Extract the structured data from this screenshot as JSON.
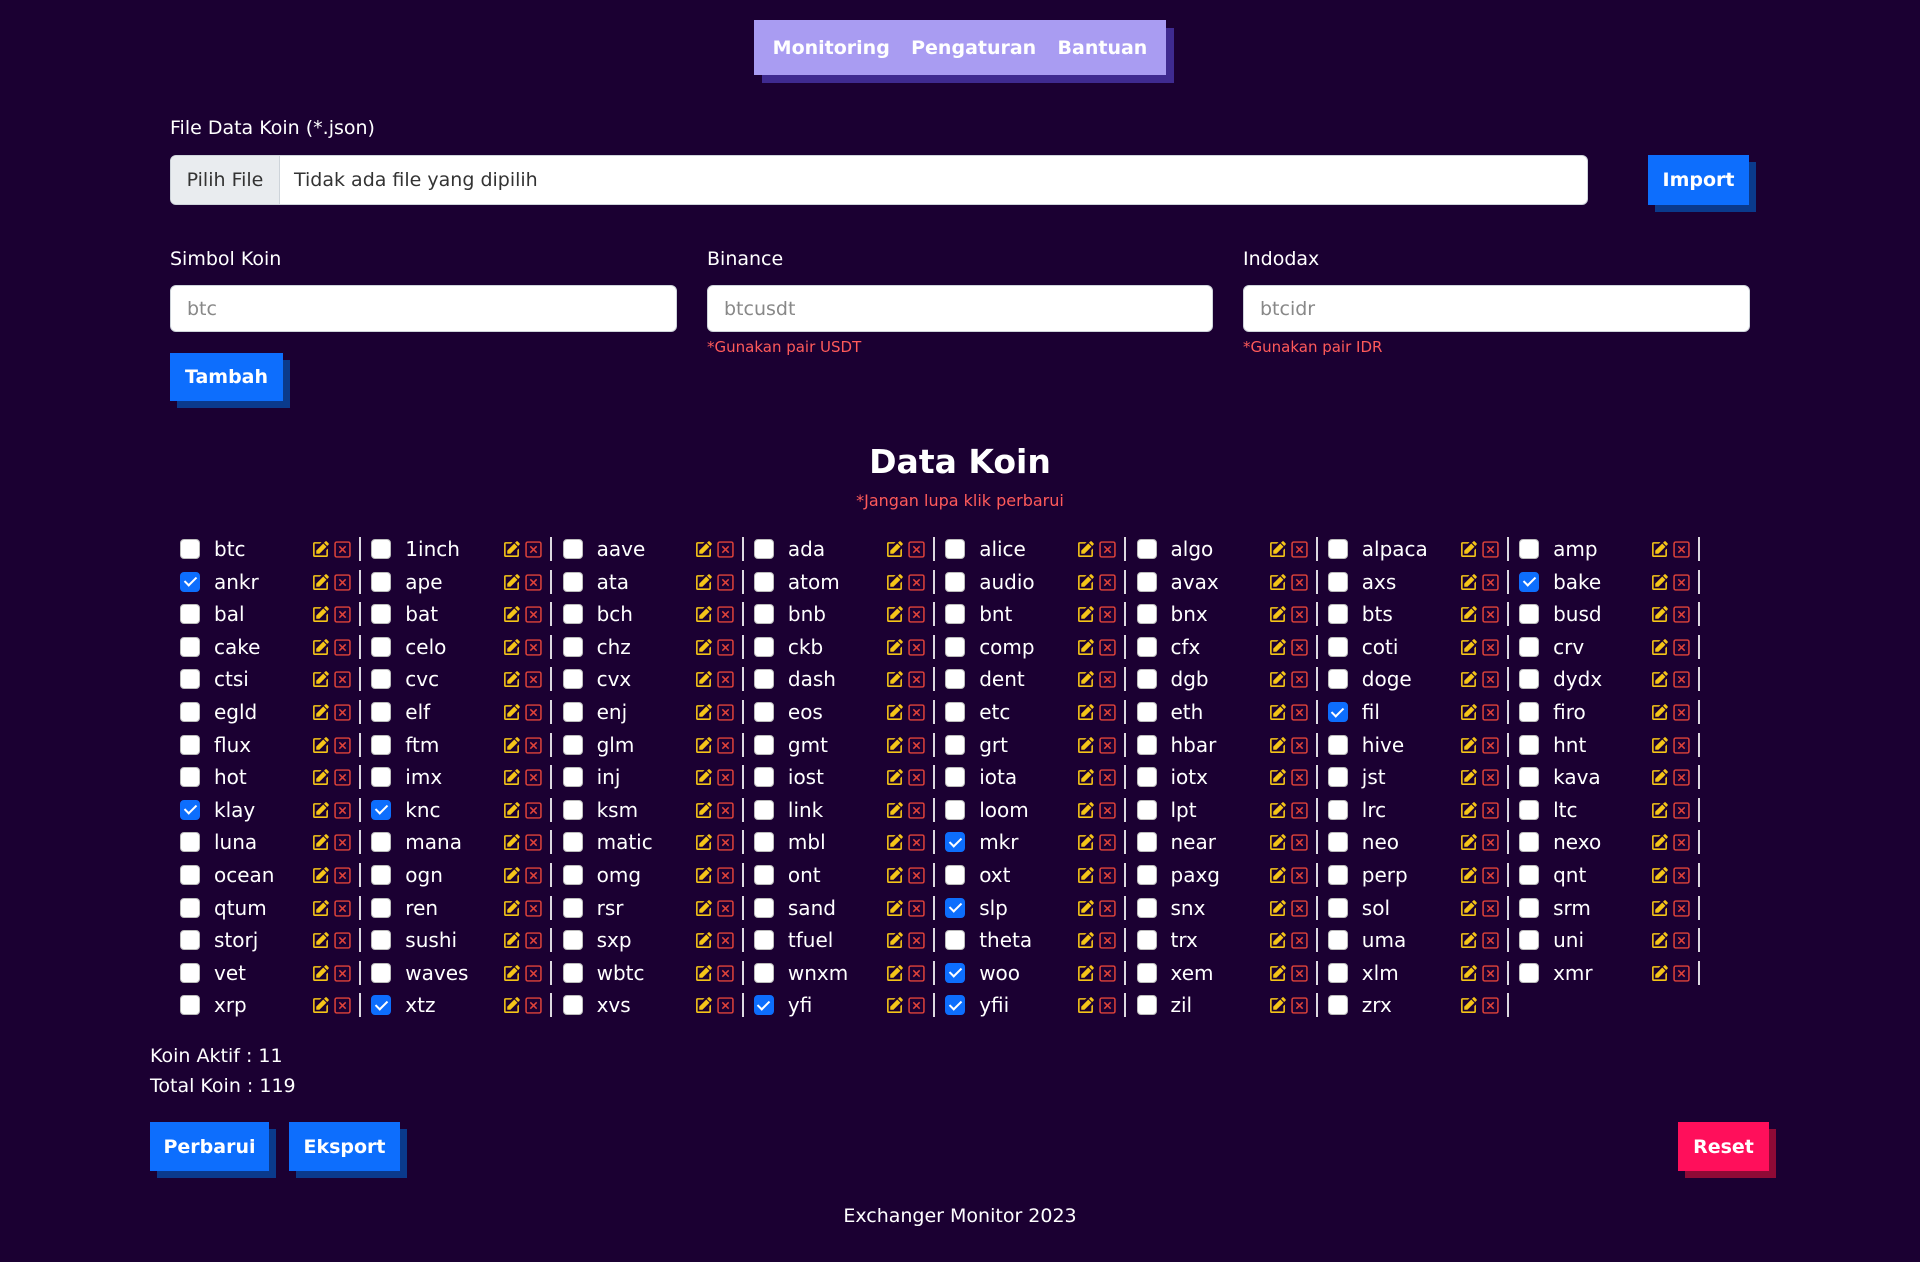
{
  "nav": {
    "items": [
      "Monitoring",
      "Pengaturan",
      "Bantuan"
    ]
  },
  "file_section": {
    "label": "File Data Koin (*.json)",
    "choose_label": "Pilih File",
    "status": "Tidak ada file yang dipilih",
    "import_label": "Import"
  },
  "form": {
    "symbol": {
      "label": "Simbol Koin",
      "placeholder": "btc"
    },
    "binance": {
      "label": "Binance",
      "placeholder": "btcusdt",
      "hint": "*Gunakan pair USDT"
    },
    "indodax": {
      "label": "Indodax",
      "placeholder": "btcidr",
      "hint": "*Gunakan pair IDR"
    },
    "add_label": "Tambah"
  },
  "data_section": {
    "title": "Data Koin",
    "hint": "*Jangan lupa klik perbarui"
  },
  "coins": [
    [
      "btc",
      "1inch",
      "aave",
      "ada",
      "alice",
      "algo",
      "alpaca",
      "amp"
    ],
    [
      "ankr",
      "ape",
      "ata",
      "atom",
      "audio",
      "avax",
      "axs",
      "bake"
    ],
    [
      "bal",
      "bat",
      "bch",
      "bnb",
      "bnt",
      "bnx",
      "bts",
      "busd"
    ],
    [
      "cake",
      "celo",
      "chz",
      "ckb",
      "comp",
      "cfx",
      "coti",
      "crv"
    ],
    [
      "ctsi",
      "cvc",
      "cvx",
      "dash",
      "dent",
      "dgb",
      "doge",
      "dydx"
    ],
    [
      "egld",
      "elf",
      "enj",
      "eos",
      "etc",
      "eth",
      "fil",
      "firo"
    ],
    [
      "flux",
      "ftm",
      "glm",
      "gmt",
      "grt",
      "hbar",
      "hive",
      "hnt"
    ],
    [
      "hot",
      "imx",
      "inj",
      "iost",
      "iota",
      "iotx",
      "jst",
      "kava"
    ],
    [
      "klay",
      "knc",
      "ksm",
      "link",
      "loom",
      "lpt",
      "lrc",
      "ltc"
    ],
    [
      "luna",
      "mana",
      "matic",
      "mbl",
      "mkr",
      "near",
      "neo",
      "nexo"
    ],
    [
      "ocean",
      "ogn",
      "omg",
      "ont",
      "oxt",
      "paxg",
      "perp",
      "qnt"
    ],
    [
      "qtum",
      "ren",
      "rsr",
      "sand",
      "slp",
      "snx",
      "sol",
      "srm"
    ],
    [
      "storj",
      "sushi",
      "sxp",
      "tfuel",
      "theta",
      "trx",
      "uma",
      "uni"
    ],
    [
      "vet",
      "waves",
      "wbtc",
      "wnxm",
      "woo",
      "xem",
      "xlm",
      "xmr"
    ],
    [
      "xrp",
      "xtz",
      "xvs",
      "yfi",
      "yfii",
      "zil",
      "zrx"
    ]
  ],
  "checked": [
    "ankr",
    "bake",
    "fil",
    "klay",
    "knc",
    "mkr",
    "slp",
    "woo",
    "xtz",
    "yfi",
    "yfii"
  ],
  "stats": {
    "active": "Koin Aktif : 11",
    "total": "Total Koin : 119"
  },
  "actions": {
    "update_label": "Perbarui",
    "export_label": "Eksport",
    "reset_label": "Reset"
  },
  "footer": "Exchanger Monitor 2023",
  "colors": {
    "background": "#1b0032",
    "nav": "#a99cf2",
    "primary": "#0d6efd",
    "danger": "#ff0f5b",
    "hint": "#ff5a5a",
    "edit_icon": "#f5c518",
    "delete_icon": "#e0433a"
  },
  "icons": {
    "edit": "pencil-square-icon",
    "delete": "x-square-icon"
  }
}
